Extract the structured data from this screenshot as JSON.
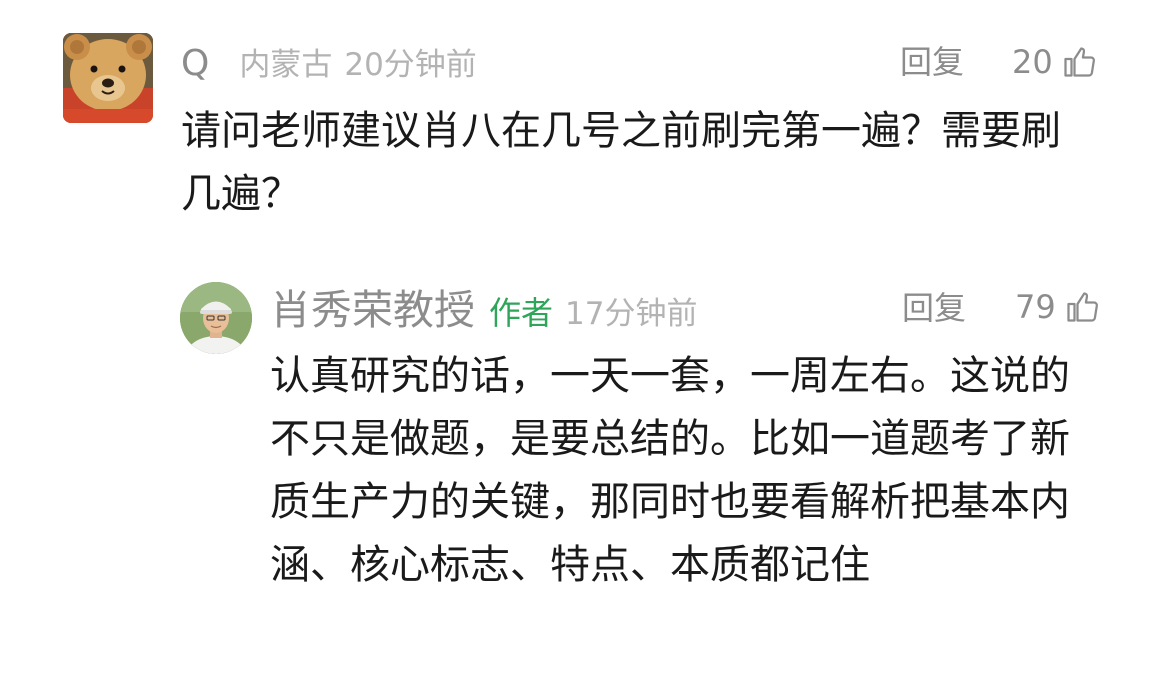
{
  "comments": [
    {
      "username": "Q",
      "location": "内蒙古",
      "time": "20分钟前",
      "reply_label": "回复",
      "like_count": "20",
      "text": "请问老师建议肖八在几号之前刷完第一遍？需要刷几遍？",
      "avatar_icon": "teddy-bear-avatar"
    }
  ],
  "reply": {
    "username": "肖秀荣教授",
    "author_tag": "作者",
    "time": "17分钟前",
    "reply_label": "回复",
    "like_count": "79",
    "text": "认真研究的话，一天一套，一周左右。这说的不只是做题，是要总结的。比如一道题考了新质生产力的关键，那同时也要看解析把基本内涵、核心标志、特点、本质都记住",
    "avatar_icon": "person-photo-avatar"
  },
  "colors": {
    "author_tag": "#2fa55a",
    "meta_gray": "#8c8c8c",
    "meta_light": "#b3b3b3",
    "text": "#1a1a1a"
  },
  "icons": {
    "like": "thumbs-up-icon"
  }
}
